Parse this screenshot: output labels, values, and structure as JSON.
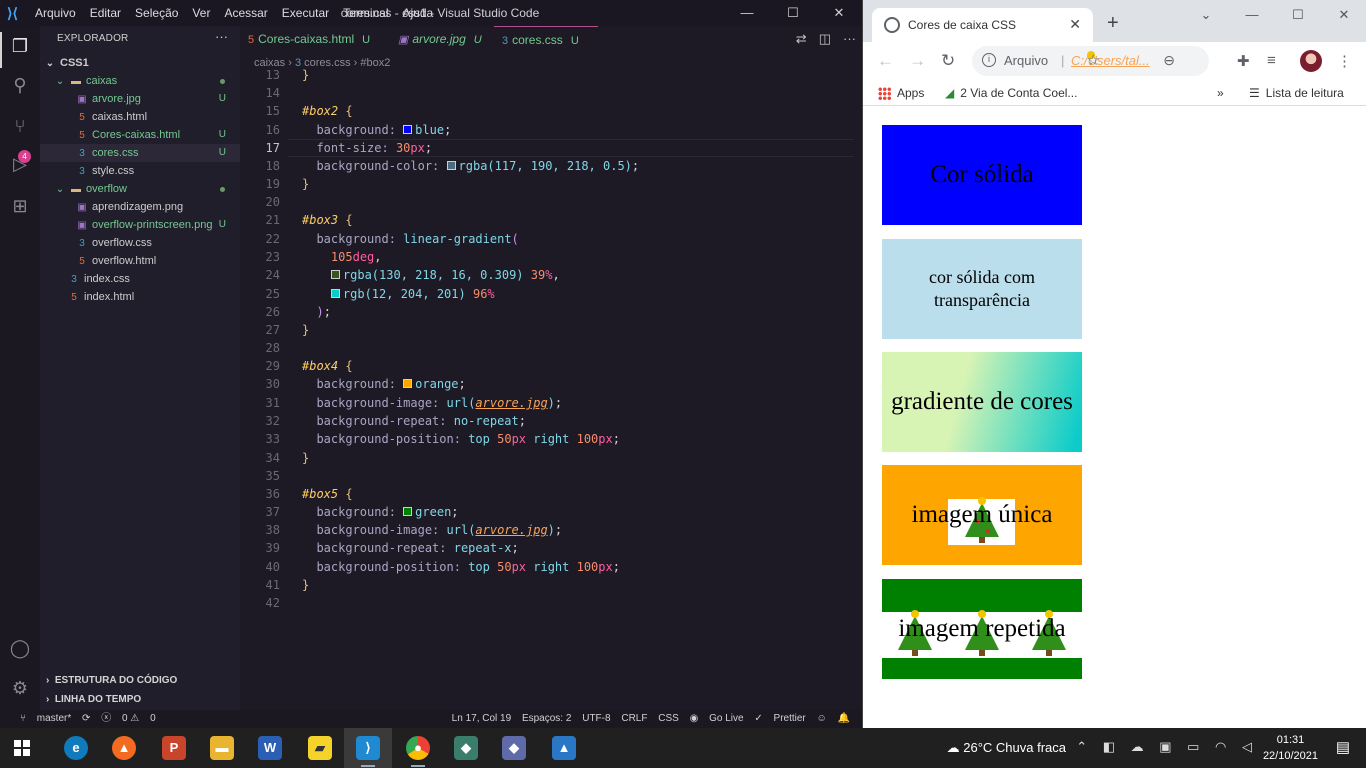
{
  "vscode": {
    "menu": [
      "Arquivo",
      "Editar",
      "Seleção",
      "Ver",
      "Acessar",
      "Executar",
      "Terminal",
      "Ajuda"
    ],
    "window_title": "cores.css - css1 - Visual Studio Code",
    "explorer_title": "EXPLORADOR",
    "project": "CSS1",
    "tree": [
      {
        "label": "caixas",
        "type": "folder",
        "status": "dot"
      },
      {
        "label": "arvore.jpg",
        "type": "img",
        "status": "U"
      },
      {
        "label": "caixas.html",
        "type": "html",
        "status": ""
      },
      {
        "label": "Cores-caixas.html",
        "type": "html",
        "status": "U"
      },
      {
        "label": "cores.css",
        "type": "css",
        "status": "U"
      },
      {
        "label": "style.css",
        "type": "css",
        "status": ""
      },
      {
        "label": "overflow",
        "type": "folder",
        "status": "dot"
      },
      {
        "label": "aprendizagem.png",
        "type": "img",
        "status": ""
      },
      {
        "label": "overflow-printscreen.png",
        "type": "img",
        "status": "U"
      },
      {
        "label": "overflow.css",
        "type": "css",
        "status": ""
      },
      {
        "label": "overflow.html",
        "type": "html",
        "status": ""
      },
      {
        "label": "index.css",
        "type": "css",
        "status": ""
      },
      {
        "label": "index.html",
        "type": "html",
        "status": ""
      }
    ],
    "sections": [
      "ESTRUTURA DO CÓDIGO",
      "LINHA DO TEMPO"
    ],
    "tabs": [
      {
        "label": "Cores-caixas.html",
        "status": "U"
      },
      {
        "label": "arvore.jpg",
        "status": "U"
      },
      {
        "label": "cores.css",
        "status": "U"
      }
    ],
    "breadcrumb": [
      "caixas",
      "cores.css",
      "#box2"
    ],
    "activity_badge": "4",
    "code_lines": [
      "13",
      "14",
      "15",
      "16",
      "17",
      "18",
      "19",
      "20",
      "21",
      "22",
      "23",
      "24",
      "25",
      "26",
      "27",
      "28",
      "29",
      "30",
      "31",
      "32",
      "33",
      "34",
      "35",
      "36",
      "37",
      "38",
      "39",
      "40",
      "41",
      "42"
    ],
    "current_line": "17",
    "status": {
      "branch": "master*",
      "problems": "0",
      "warnings": "0",
      "position": "Ln 17, Col 19",
      "spaces": "Espaços: 2",
      "encoding": "UTF-8",
      "eol": "CRLF",
      "language": "CSS",
      "golive": "Go Live",
      "prettier": "Prettier"
    }
  },
  "chrome": {
    "tab_title": "Cores de caixa CSS",
    "omnibox_label": "Arquivo",
    "omnibox_url": "C:/Users/tal...",
    "bookmarks": [
      "Apps",
      "2 Via de Conta Coel...",
      "Lista de leitura"
    ],
    "boxes": [
      {
        "text": "Cor sólida"
      },
      {
        "text": "cor sólida com transparência"
      },
      {
        "text": "gradiente de cores"
      },
      {
        "text": "imagem única"
      },
      {
        "text": "imagem repetida"
      }
    ]
  },
  "taskbar": {
    "weather": "26°C  Chuva fraca",
    "time": "01:31",
    "date": "22/10/2021"
  },
  "colors": {
    "box1": "#0000ff",
    "box4": "#ffa500",
    "box5": "#008000",
    "accent": "#b14f8b"
  }
}
